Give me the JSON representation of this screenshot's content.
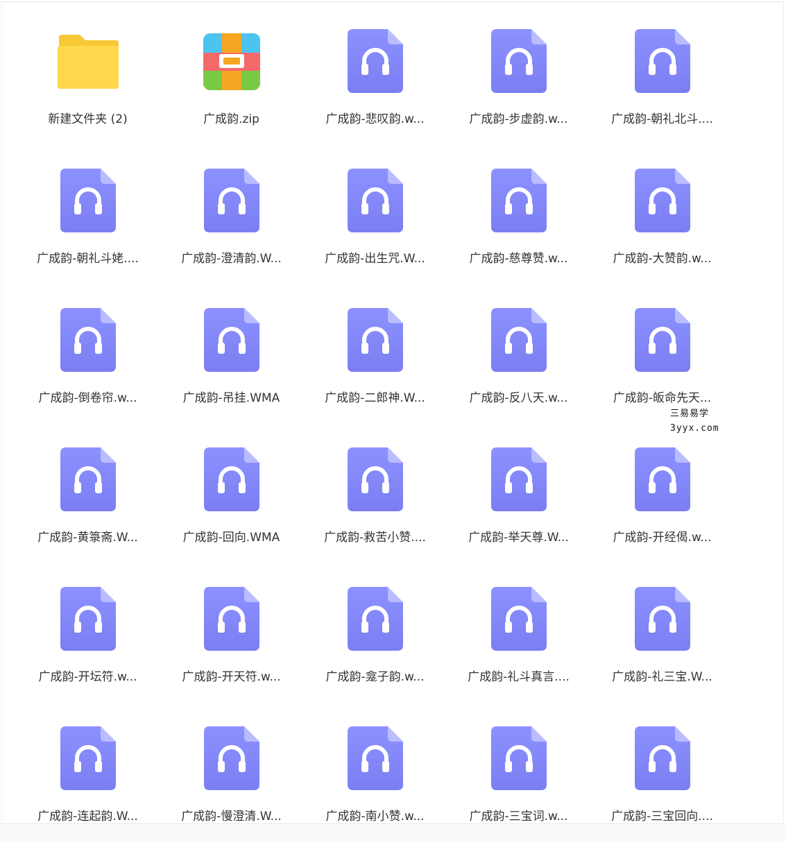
{
  "colors": {
    "audio_icon_top": "#8C91FF",
    "audio_icon_bottom": "#7B7EF2",
    "audio_icon_fold": "#B9BCFF",
    "folder_back": "#F8C936",
    "folder_front": "#FFD84C",
    "label_text": "#333333"
  },
  "watermark": {
    "line1": "三易易学",
    "line2": "3yyx.com"
  },
  "items": [
    {
      "icon": "folder-icon",
      "label": "新建文件夹 (2)"
    },
    {
      "icon": "zip-archive-icon",
      "label": "广成韵.zip"
    },
    {
      "icon": "audio-file-icon",
      "label": "广成韵-悲叹韵.w..."
    },
    {
      "icon": "audio-file-icon",
      "label": "广成韵-步虚韵.w..."
    },
    {
      "icon": "audio-file-icon",
      "label": "广成韵-朝礼北斗...."
    },
    {
      "icon": "audio-file-icon",
      "label": "广成韵-朝礼斗姥...."
    },
    {
      "icon": "audio-file-icon",
      "label": "广成韵-澄清韵.W..."
    },
    {
      "icon": "audio-file-icon",
      "label": "广成韵-出生咒.W..."
    },
    {
      "icon": "audio-file-icon",
      "label": "广成韵-慈尊赞.w..."
    },
    {
      "icon": "audio-file-icon",
      "label": "广成韵-大赞韵.w..."
    },
    {
      "icon": "audio-file-icon",
      "label": "广成韵-倒卷帘.w..."
    },
    {
      "icon": "audio-file-icon",
      "label": "广成韵-吊挂.WMA"
    },
    {
      "icon": "audio-file-icon",
      "label": "广成韵-二郎神.W..."
    },
    {
      "icon": "audio-file-icon",
      "label": "广成韵-反八天.w..."
    },
    {
      "icon": "audio-file-icon",
      "label": "广成韵-皈命先天..."
    },
    {
      "icon": "audio-file-icon",
      "label": "广成韵-黄箓斋.W..."
    },
    {
      "icon": "audio-file-icon",
      "label": "广成韵-回向.WMA"
    },
    {
      "icon": "audio-file-icon",
      "label": "广成韵-救苦小赞...."
    },
    {
      "icon": "audio-file-icon",
      "label": "广成韵-举天尊.W..."
    },
    {
      "icon": "audio-file-icon",
      "label": "广成韵-开经偈.w..."
    },
    {
      "icon": "audio-file-icon",
      "label": "广成韵-开坛符.w..."
    },
    {
      "icon": "audio-file-icon",
      "label": "广成韵-开天符.w..."
    },
    {
      "icon": "audio-file-icon",
      "label": "广成韵-龛子韵.w..."
    },
    {
      "icon": "audio-file-icon",
      "label": "广成韵-礼斗真言...."
    },
    {
      "icon": "audio-file-icon",
      "label": "广成韵-礼三宝.W..."
    },
    {
      "icon": "audio-file-icon",
      "label": "广成韵-连起韵.W..."
    },
    {
      "icon": "audio-file-icon",
      "label": "广成韵-慢澄清.W..."
    },
    {
      "icon": "audio-file-icon",
      "label": "广成韵-南小赞.w..."
    },
    {
      "icon": "audio-file-icon",
      "label": "广成韵-三宝词.w..."
    },
    {
      "icon": "audio-file-icon",
      "label": "广成韵-三宝回向...."
    }
  ]
}
